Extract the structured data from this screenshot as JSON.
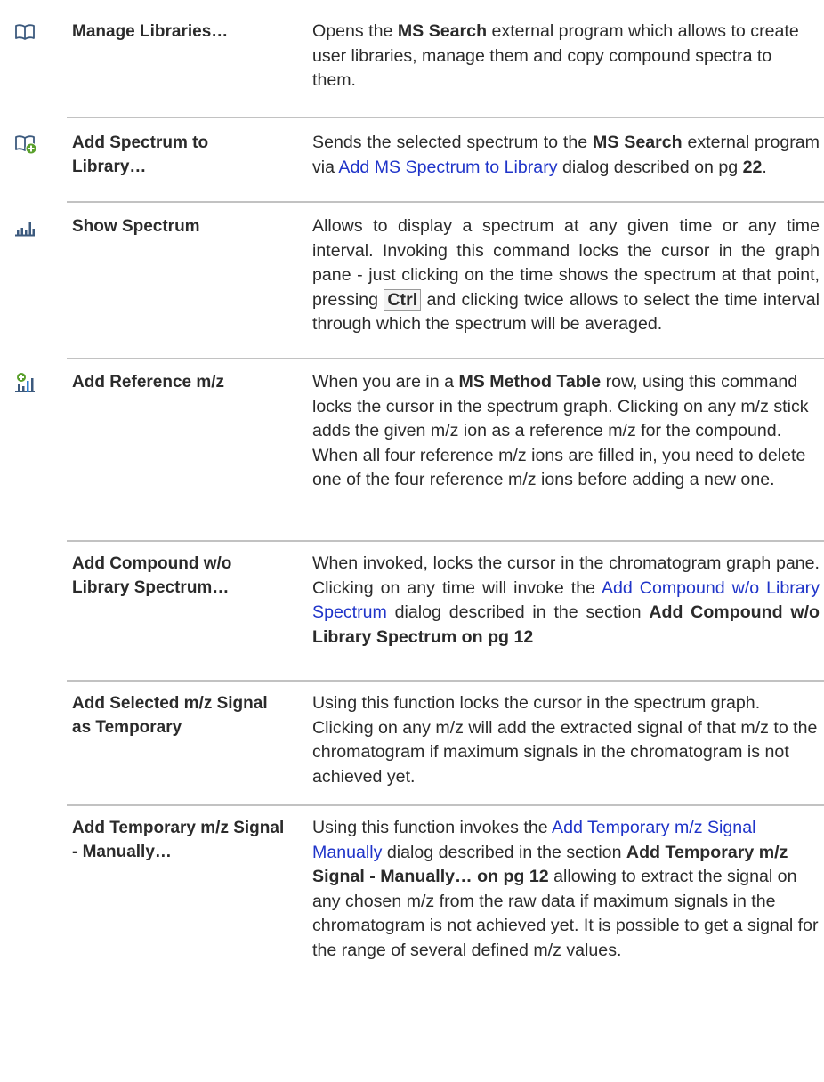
{
  "colors": {
    "link": "#1f34c9",
    "divider": "#c2c2c2",
    "text": "#2b2b2b",
    "icon": "#3c5a7e",
    "icon_accent": "#5aa02c"
  },
  "rows": [
    {
      "icon": "book-icon",
      "command": "Manage Libraries…",
      "desc": {
        "t1": "Opens the ",
        "b1": "MS Search",
        "t2": " external program which allows to create user libraries, manage them and copy compound spectra to them."
      }
    },
    {
      "icon": "book-add-icon",
      "command": "Add Spectrum to Library…",
      "desc": {
        "t1": "Sends the selected spectrum to the ",
        "b1": "MS Search",
        "t2": " external program via ",
        "link": "Add MS Spectrum to Library",
        "t3": " dialog described on pg ",
        "b2": "22",
        "t4": "."
      }
    },
    {
      "icon": "spectrum-icon",
      "command": "Show Spectrum",
      "desc": {
        "t1": "Allows to display a spectrum at any given time or any time interval. Invoking this command locks the cursor in the graph pane - just clicking on the time shows the spectrum at that point, pressing ",
        "kbd": "Ctrl",
        "t2": " and clicking twice allows to select the time interval through which the spectrum will be averaged."
      }
    },
    {
      "icon": "reference-mz-icon",
      "command": "Add Reference m/z",
      "desc": {
        "t1": "When you are in a ",
        "b1": "MS Method Table",
        "t2": " row, using this command locks the cursor in the spectrum graph. Clicking on any m/z stick adds the given m/z ion as a reference m/z for the compound. When all four reference m/z ions are filled in, you need to delete one of the four reference m/z ions before adding a new one."
      }
    },
    {
      "icon": "",
      "command": "Add Compound w/o Library Spectrum…",
      "desc": {
        "t1": "When invoked, locks the cursor in the chromatogram graph pane. Clicking on any time will invoke the ",
        "link": "Add Compound w/o Library Spectrum",
        "t2": " dialog described in the section ",
        "b1": "Add Compound w/o Library Spectrum on pg 12"
      }
    },
    {
      "icon": "",
      "command": "Add Selected m/z Signal as Temporary",
      "desc": {
        "t1": "Using this function locks the cursor in the spectrum graph. Clicking on any m/z will add the extracted signal of that m/z to the chromatogram if maximum signals in the chromatogram is not achieved yet."
      }
    },
    {
      "icon": "",
      "command": "Add Temporary m/z Signal - Manually…",
      "desc": {
        "t1": "Using this function invokes the ",
        "link": "Add Temporary m/z Signal Manually",
        "t2": " dialog described in the section ",
        "b1": "Add Temporary m/z Signal - Manually… on pg 12",
        "t3": " allowing to extract the signal on any chosen m/z from the raw data if maximum signals in the chromatogram is not achieved yet. It is possible to get a signal for the range of several defined m/z values."
      }
    }
  ]
}
